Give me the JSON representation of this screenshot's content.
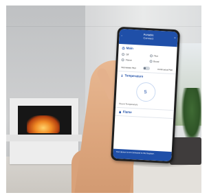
{
  "app": {
    "header_title": "Portable",
    "header_subtitle": "Connect",
    "header_left": "‹",
    "header_right": "≡"
  },
  "main_section": {
    "title": "Main",
    "icon": "power-icon",
    "options": [
      "Off",
      "Pilot",
      "Flame",
      "Boost"
    ],
    "toggle_left": "Intermittent Pilot",
    "toggle_right": "Continuous Pilot"
  },
  "temperature_section": {
    "title": "Temperature",
    "icon": "thermometer-icon",
    "dial_value": "5",
    "room_label": "Room Temperature"
  },
  "flame_section": {
    "title": "Flame",
    "icon": "flame-icon"
  },
  "footer": {
    "text": "Your device is not connected to this fireplace."
  },
  "colors": {
    "accent": "#1f4fa8",
    "screen_bg": "#ffffff"
  }
}
